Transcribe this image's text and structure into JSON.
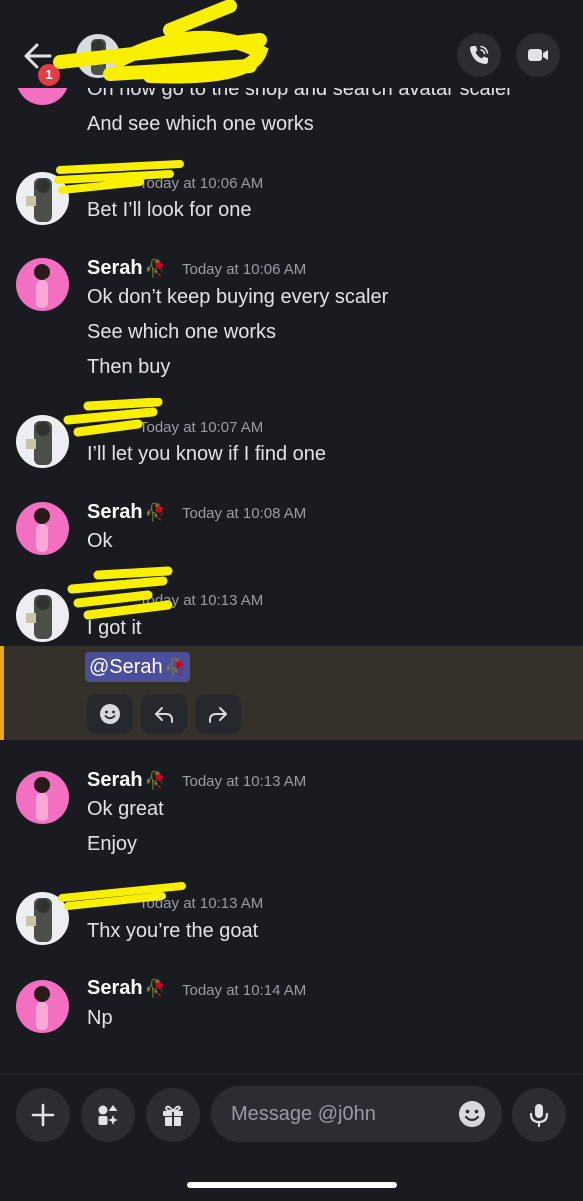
{
  "header": {
    "notification_count": "1",
    "title": ""
  },
  "messages": {
    "m0": {
      "text1": "Oh now go to the shop and search avatar scaler",
      "text2": "And see which one works"
    },
    "m1": {
      "timestamp": "Today at 10:06 AM",
      "text1": "Bet I’ll look for one"
    },
    "m2": {
      "author": "Serah",
      "rose": "🥀",
      "timestamp": "Today at 10:06 AM",
      "text1": "Ok don’t keep buying every scaler",
      "text2": "See which one works",
      "text3": "Then buy"
    },
    "m3": {
      "timestamp": "Today at 10:07 AM",
      "text1": "I’ll let you know if I find one"
    },
    "m4": {
      "author": "Serah",
      "rose": "🥀",
      "timestamp": "Today at 10:08 AM",
      "text1": "Ok"
    },
    "m5": {
      "timestamp": "Today at 10:13 AM",
      "text1": "I got it",
      "mention": "@Serah",
      "mention_rose": "🥀"
    },
    "m6": {
      "author": "Serah",
      "rose": "🥀",
      "timestamp": "Today at 10:13 AM",
      "text1": "Ok great",
      "text2": "Enjoy"
    },
    "m7": {
      "timestamp": "Today at 10:13 AM",
      "text1": "Thx you’re the goat"
    },
    "m8": {
      "author": "Serah",
      "rose": "🥀",
      "timestamp": "Today at 10:14 AM",
      "text1": "Np"
    }
  },
  "composer": {
    "placeholder": "Message @j0hn"
  },
  "icons": {
    "back": "arrow-left-icon",
    "call": "phone-call-icon",
    "video": "video-camera-icon",
    "add": "plus-icon",
    "apps": "apps-icon",
    "gift": "gift-icon",
    "emoji": "smiley-icon",
    "mic": "microphone-icon",
    "reply": "reply-arrow-icon",
    "forward": "forward-arrow-icon"
  },
  "colors": {
    "background": "#1a1b20",
    "highlight": "#34302a",
    "highlight_border": "#e8a825",
    "mention_bg": "#4b4f9a",
    "badge": "#e03e42",
    "female_avatar": "#f36fc2",
    "scribble": "#f8f000"
  }
}
